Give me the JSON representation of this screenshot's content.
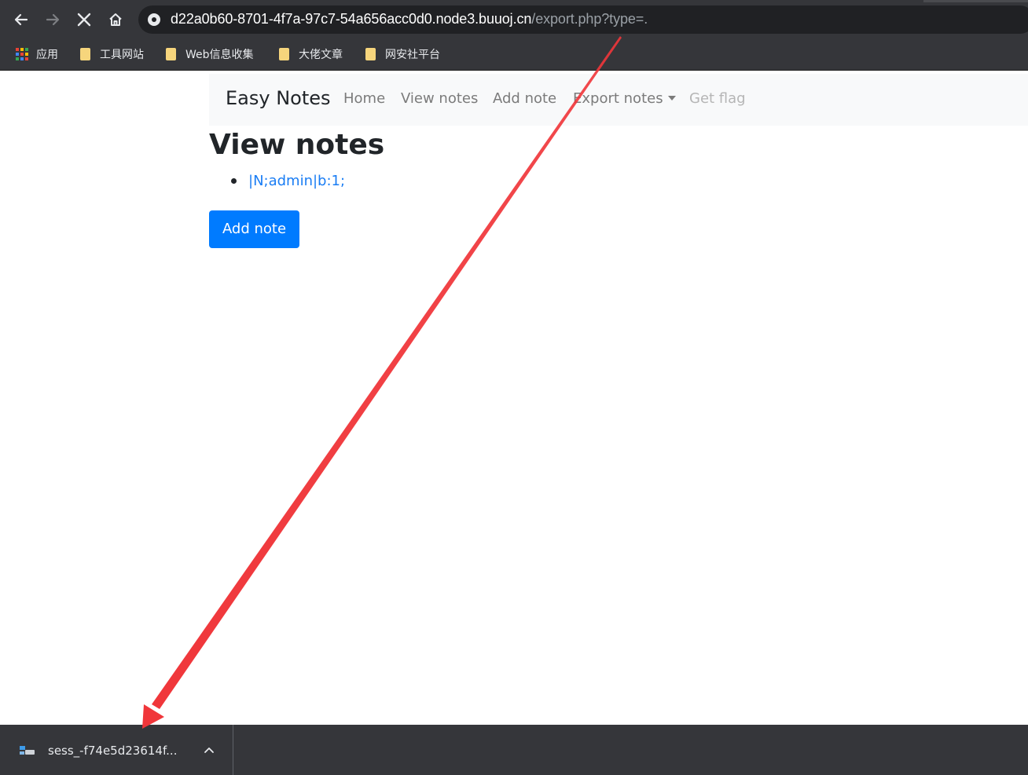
{
  "browser": {
    "url_host": "d22a0b60-8701-4f7a-97c7-54a656acc0d0.node3.buuoj.cn",
    "url_path": "/export.php?type=.",
    "icons": {
      "back": "arrow-left-icon",
      "forward": "arrow-right-icon",
      "stop": "close-icon",
      "home": "home-icon",
      "site_info": "globe-icon"
    }
  },
  "bookmarks": [
    {
      "label": "应用",
      "icon": "apps-icon"
    },
    {
      "label": "工具网站",
      "icon": "folder-icon"
    },
    {
      "label": "Web信息收集",
      "icon": "folder-icon"
    },
    {
      "label": "大佬文章",
      "icon": "folder-icon"
    },
    {
      "label": "网安社平台",
      "icon": "folder-icon"
    }
  ],
  "navbar": {
    "brand": "Easy Notes",
    "links": [
      {
        "label": "Home"
      },
      {
        "label": "View notes"
      },
      {
        "label": "Add note"
      },
      {
        "label": "Export notes"
      },
      {
        "label": "Get flag",
        "disabled": true
      }
    ]
  },
  "main": {
    "heading": "View notes",
    "notes": [
      "|N;admin|b:1;"
    ],
    "add_button": "Add note"
  },
  "downloads": {
    "filename": "sess_-f74e5d23614f..."
  },
  "colors": {
    "chrome_bg": "#35363a",
    "omnibox_bg": "#202124",
    "link_blue": "#1a7df4",
    "primary_button": "#007bff",
    "annotation_arrow": "#f0363a"
  }
}
